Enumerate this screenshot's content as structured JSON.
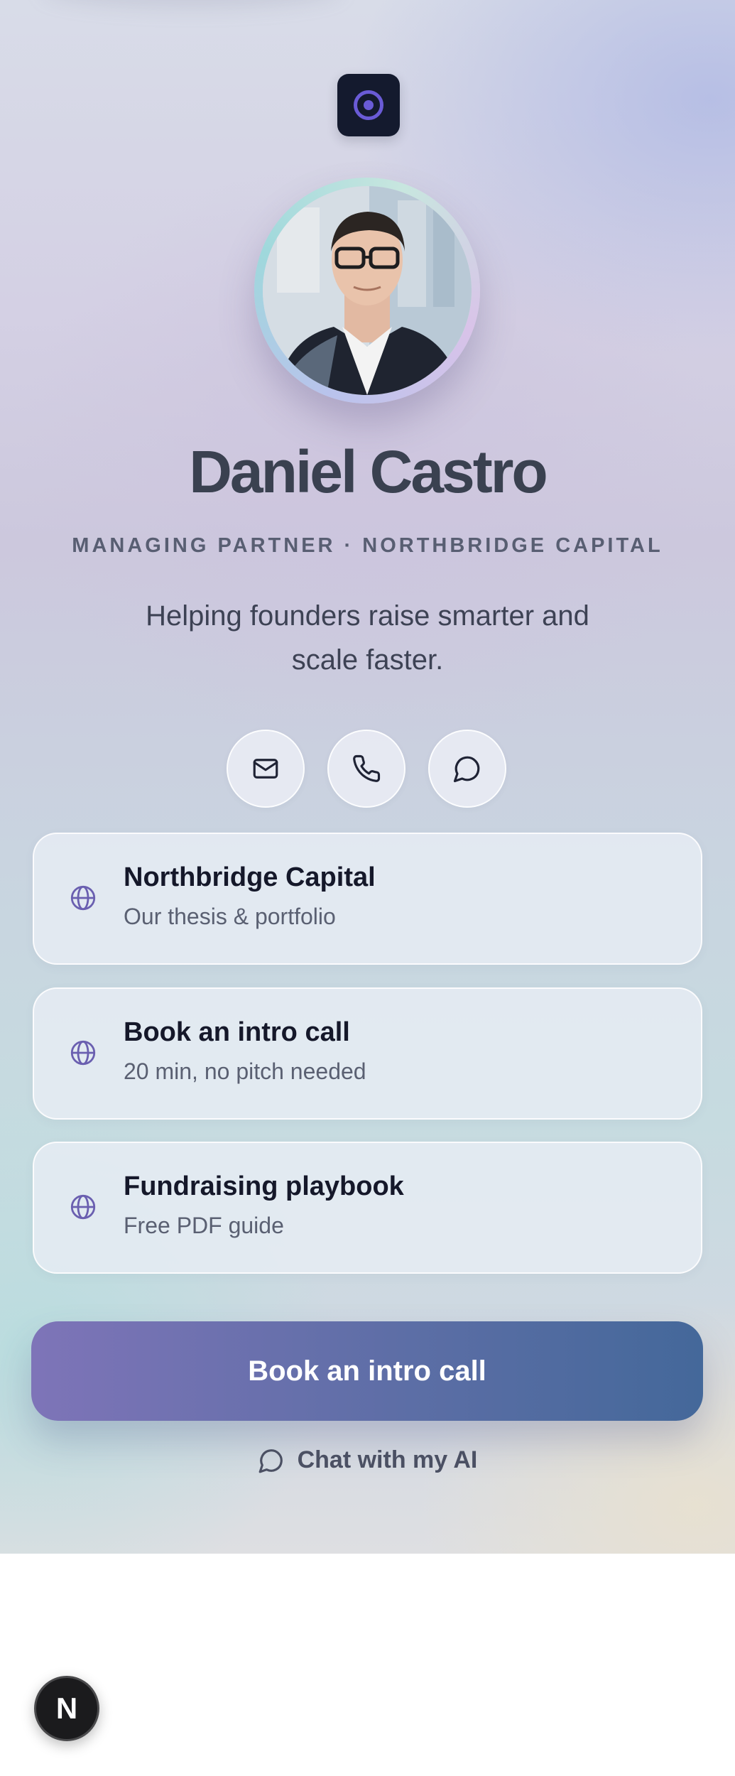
{
  "profile": {
    "name": "Daniel Castro",
    "subtitle": "MANAGING PARTNER · NORTHBRIDGE CAPITAL",
    "tagline": "Helping founders raise smarter and scale faster."
  },
  "contact_buttons": [
    {
      "icon": "mail-icon"
    },
    {
      "icon": "phone-icon"
    },
    {
      "icon": "chat-bubble-icon"
    }
  ],
  "links": [
    {
      "title": "Northbridge Capital",
      "subtitle": "Our thesis & portfolio",
      "icon": "globe-icon"
    },
    {
      "title": "Book an intro call",
      "subtitle": "20 min, no pitch needed",
      "icon": "globe-icon"
    },
    {
      "title": "Fundraising playbook",
      "subtitle": "Free PDF guide",
      "icon": "globe-icon"
    }
  ],
  "cta": {
    "label": "Book an intro call"
  },
  "chat": {
    "label": "Chat with my AI"
  },
  "fab": {
    "label": "N"
  },
  "colors": {
    "accent": "#6a5bd6",
    "cta_start": "#7e74b8",
    "cta_end": "#44689a",
    "logo_bg": "#141a2e"
  }
}
